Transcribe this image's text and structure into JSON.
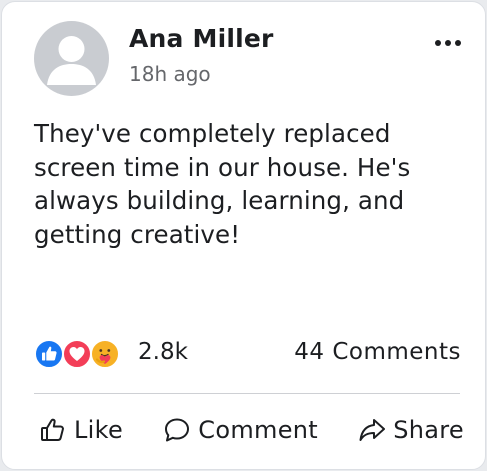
{
  "post": {
    "author": {
      "name": "Ana Miller",
      "avatar_icon": "default-avatar-icon"
    },
    "timestamp": "18h ago",
    "more_icon": "more-options-icon",
    "text": "They've completely replaced screen time in our house. He's always building, learning, and getting creative!",
    "reactions": {
      "icons": [
        "like-reaction-icon",
        "love-reaction-icon",
        "care-reaction-icon"
      ],
      "count": "2.8k"
    },
    "comments_count": "44 Comments",
    "actions": {
      "like_label": "Like",
      "comment_label": "Comment",
      "share_label": "Share"
    }
  },
  "colors": {
    "like_blue": "#1877f2",
    "love_red": "#f33e58",
    "care_yellow": "#f7b125",
    "avatar_gray": "#c9ccd1",
    "secondary_text": "#65676b"
  }
}
